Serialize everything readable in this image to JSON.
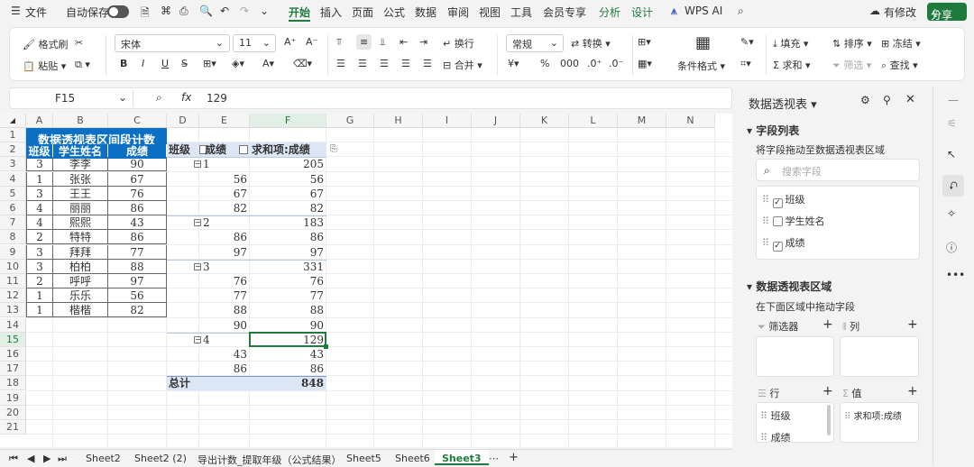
{
  "menu": {
    "file": "文件",
    "autosave": "自动保存",
    "tabs": [
      "开始",
      "插入",
      "页面",
      "公式",
      "数据",
      "审阅",
      "视图",
      "工具",
      "会员专享",
      "分析",
      "设计"
    ],
    "wps_ai": "WPS AI",
    "modified": "有修改",
    "share": "分享"
  },
  "ribbon": {
    "format_painter": "格式刷",
    "paste": "粘贴",
    "font_name": "宋体",
    "font_size": "11",
    "wrap": "换行",
    "merge": "合并",
    "number_format": "常规",
    "convert": "转换",
    "cond_format": "条件格式",
    "fill": "填充",
    "sort": "排序",
    "freeze": "冻结",
    "sum": "求和",
    "filter": "筛选",
    "find": "查找",
    "bold": "B",
    "italic": "I",
    "underline": "U",
    "percent": "%"
  },
  "formula_bar": {
    "cell": "F15",
    "fx": "fx",
    "value": "129"
  },
  "columns": [
    "A",
    "B",
    "C",
    "D",
    "E",
    "F",
    "G",
    "H",
    "I",
    "J",
    "K",
    "L",
    "M",
    "N"
  ],
  "rows": [
    "1",
    "2",
    "3",
    "4",
    "5",
    "6",
    "7",
    "8",
    "9",
    "10",
    "11",
    "12",
    "13",
    "14",
    "15",
    "16",
    "17",
    "18",
    "19",
    "20",
    "21"
  ],
  "table": {
    "title": "数据透视表区间段计数",
    "headers": [
      "班级",
      "学生姓名",
      "成绩"
    ],
    "rows": [
      [
        "3",
        "李李",
        "90"
      ],
      [
        "1",
        "张张",
        "67"
      ],
      [
        "3",
        "王王",
        "76"
      ],
      [
        "4",
        "丽丽",
        "86"
      ],
      [
        "4",
        "熙熙",
        "43"
      ],
      [
        "2",
        "特特",
        "86"
      ],
      [
        "3",
        "拜拜",
        "77"
      ],
      [
        "3",
        "柏柏",
        "88"
      ],
      [
        "2",
        "呼呼",
        "97"
      ],
      [
        "1",
        "乐乐",
        "56"
      ],
      [
        "1",
        "楷楷",
        "82"
      ]
    ]
  },
  "pivot": {
    "h_class": "班级",
    "h_score": "成绩",
    "h_sum": "求和项:成绩",
    "rows": [
      {
        "group": "1",
        "score": "",
        "sum": "205"
      },
      {
        "group": "",
        "score": "56",
        "sum": "56"
      },
      {
        "group": "",
        "score": "67",
        "sum": "67"
      },
      {
        "group": "",
        "score": "82",
        "sum": "82"
      },
      {
        "group": "2",
        "score": "",
        "sum": "183"
      },
      {
        "group": "",
        "score": "86",
        "sum": "86"
      },
      {
        "group": "",
        "score": "97",
        "sum": "97"
      },
      {
        "group": "3",
        "score": "",
        "sum": "331"
      },
      {
        "group": "",
        "score": "76",
        "sum": "76"
      },
      {
        "group": "",
        "score": "77",
        "sum": "77"
      },
      {
        "group": "",
        "score": "88",
        "sum": "88"
      },
      {
        "group": "",
        "score": "90",
        "sum": "90"
      },
      {
        "group": "4",
        "score": "",
        "sum": "129"
      },
      {
        "group": "",
        "score": "43",
        "sum": "43"
      },
      {
        "group": "",
        "score": "86",
        "sum": "86"
      }
    ],
    "total_label": "总计",
    "total": "848"
  },
  "sheets": [
    "Sheet2",
    "Sheet2 (2)",
    "导出计数_提取年级（公式结果）",
    "Sheet5",
    "Sheet6",
    "Sheet3"
  ],
  "active_sheet": "Sheet3",
  "panel": {
    "title": "数据透视表",
    "field_list": "字段列表",
    "drag_hint": "将字段拖动至数据透视表区域",
    "search_placeholder": "搜索字段",
    "fields": [
      {
        "name": "班级",
        "checked": true
      },
      {
        "name": "学生姓名",
        "checked": false
      },
      {
        "name": "成绩",
        "checked": true
      }
    ],
    "areas_title": "数据透视表区域",
    "areas_hint": "在下面区域中拖动字段",
    "filter": "筛选器",
    "columns": "列",
    "rows": "行",
    "values": "值",
    "row_items": [
      "班级",
      "成绩"
    ],
    "value_items": [
      "求和项:成绩"
    ]
  },
  "colors": {
    "header_blue": "#0b6fc3",
    "pivot_header": "#dce6f5",
    "accent_green": "#1f7a3e",
    "active_tab": "#1f7a3e"
  }
}
